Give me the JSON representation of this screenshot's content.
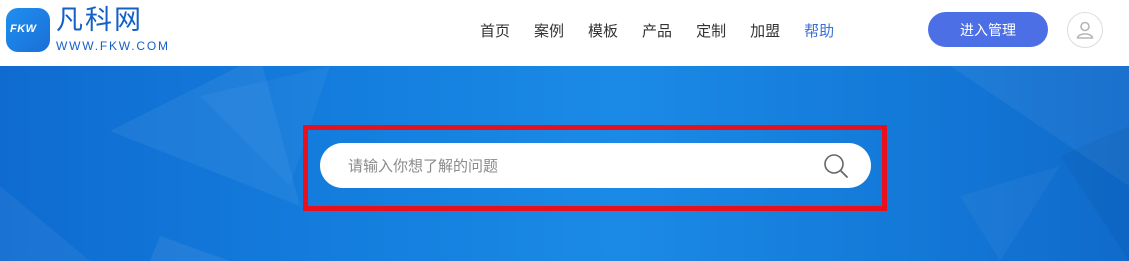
{
  "logo": {
    "badge_text": "FKW",
    "name_cn": "凡科网",
    "name_en": "WWW.FKW.COM"
  },
  "nav": {
    "items": [
      {
        "label": "首页"
      },
      {
        "label": "案例"
      },
      {
        "label": "模板"
      },
      {
        "label": "产品"
      },
      {
        "label": "定制"
      },
      {
        "label": "加盟"
      },
      {
        "label": "帮助",
        "active": true
      }
    ],
    "active_color": "#3a6fd8"
  },
  "header": {
    "manage_button": "进入管理",
    "manage_button_color": "#4d6fe6",
    "avatar_icon": "user-icon"
  },
  "banner": {
    "background": "#1580df"
  },
  "search": {
    "placeholder": "请输入你想了解的问题",
    "value": "",
    "icon": "search-icon",
    "highlight_color": "#e8101d"
  }
}
